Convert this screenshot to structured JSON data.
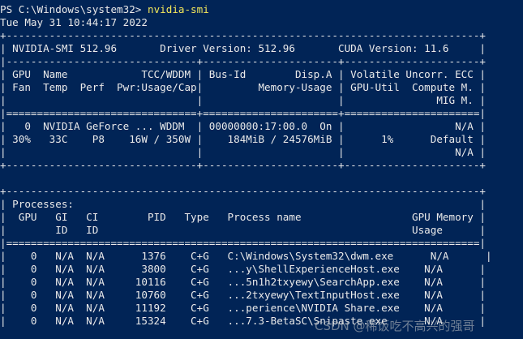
{
  "prompt": {
    "path": "PS C:\\Windows\\system32> ",
    "command": "nvidia-smi"
  },
  "timestamp": "Tue May 31 10:44:17 2022",
  "gpu_table": {
    "border_top": "+-----------------------------------------------------------------------------+",
    "version_line": "| NVIDIA-SMI 512.96       Driver Version: 512.96       CUDA Version: 11.6     |",
    "separator_1": "|-------------------------------+----------------------+----------------------+",
    "header_1": "| GPU  Name            TCC/WDDM | Bus-Id        Disp.A | Volatile Uncorr. ECC |",
    "header_2": "| Fan  Temp  Perf  Pwr:Usage/Cap|         Memory-Usage | GPU-Util  Compute M. |",
    "header_3": "|                               |                      |               MIG M. |",
    "separator_2": "|===============================+======================+======================|",
    "row_1": "|   0  NVIDIA GeForce ... WDDM  | 00000000:17:00.0  On |                  N/A |",
    "row_2": "| 30%   33C    P8    16W / 350W |    184MiB / 24576MiB |      1%      Default |",
    "row_3": "|                               |                      |                  N/A |",
    "border_bottom": "+-------------------------------+----------------------+----------------------+"
  },
  "process_table": {
    "border_top": "+-----------------------------------------------------------------------------+",
    "title": "| Processes:                                                                  |",
    "header_1": "|  GPU   GI   CI        PID   Type   Process name                  GPU Memory |",
    "header_2": "|        ID   ID                                                   Usage      |",
    "separator": "|=============================================================================|",
    "rows": [
      "|    0   N/A  N/A      1376    C+G   C:\\Windows\\System32\\dwm.exe      N/A      |",
      "|    0   N/A  N/A      3800    C+G   ...y\\ShellExperienceHost.exe    N/A      |",
      "|    0   N/A  N/A     10116    C+G   ...5n1h2txyewy\\SearchApp.exe    N/A      |",
      "|    0   N/A  N/A     10760    C+G   ...2txyewy\\TextInputHost.exe    N/A      |",
      "|    0   N/A  N/A     11192    C+G   ...perience\\NVIDIA Share.exe    N/A      |",
      "|    0   N/A  N/A     15324    C+G   ...7.3-BetaSC\\Snipaste.exe      N/A      |"
    ]
  },
  "watermark": "CSDN @稀饭吃不高兴的强哥"
}
